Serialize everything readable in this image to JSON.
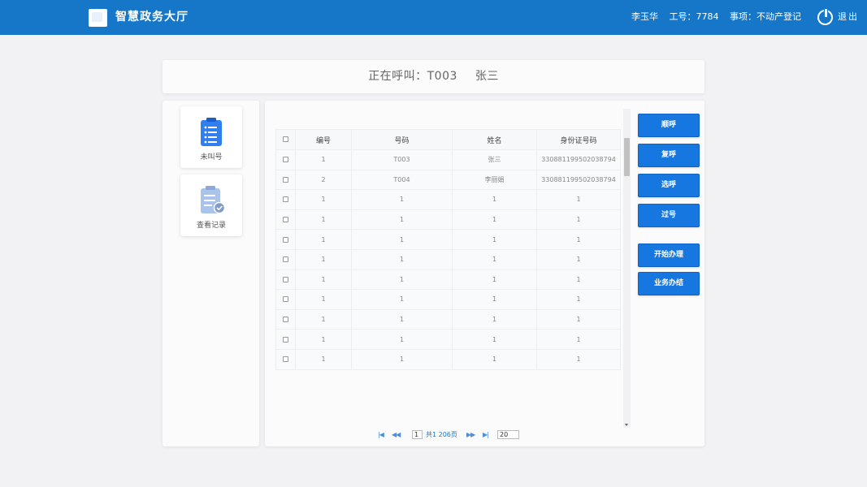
{
  "header": {
    "app_title": "智慧政务大厅",
    "user_name": "李玉华",
    "employee_no": "工号：7784",
    "matter": "事项：不动产登记",
    "logout_label": "退出",
    "brand_color": "#1677c9"
  },
  "banner": {
    "calling_label": "正在呼叫：T003",
    "calling_name": "张三"
  },
  "nav": {
    "items": [
      {
        "label": "未叫号",
        "icon": "clipboard-list-icon"
      },
      {
        "label": "查看记录",
        "icon": "clipboard-check-icon"
      }
    ]
  },
  "table": {
    "headers": [
      "编号",
      "号码",
      "姓名",
      "身份证号码"
    ],
    "rows": [
      [
        "1",
        "T003",
        "张三",
        "330881199502038794"
      ],
      [
        "2",
        "T004",
        "李丽娟",
        "330881199502038794"
      ],
      [
        "1",
        "1",
        "1",
        "1"
      ],
      [
        "1",
        "1",
        "1",
        "1"
      ],
      [
        "1",
        "1",
        "1",
        "1"
      ],
      [
        "1",
        "1",
        "1",
        "1"
      ],
      [
        "1",
        "1",
        "1",
        "1"
      ],
      [
        "1",
        "1",
        "1",
        "1"
      ],
      [
        "1",
        "1",
        "1",
        "1"
      ],
      [
        "1",
        "1",
        "1",
        "1"
      ],
      [
        "1",
        "1",
        "1",
        "1"
      ]
    ]
  },
  "pager": {
    "first": "|◀",
    "prev": "◀◀",
    "current_page": "1",
    "total": "共1 206页",
    "next": "▶▶",
    "last": "▶|",
    "page_size": "20"
  },
  "actions": {
    "sequential_call": "顺呼",
    "recall": "复呼",
    "select_call": "选呼",
    "skip": "过号",
    "start_processing": "开始办理",
    "finish_business": "业务办结"
  }
}
